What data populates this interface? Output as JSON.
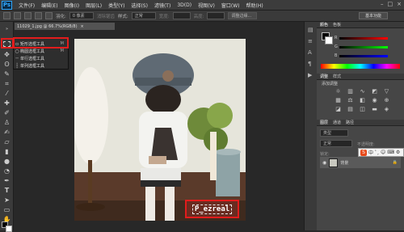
{
  "app": {
    "logo": "Ps"
  },
  "menubar": {
    "items": [
      "文件(F)",
      "编辑(E)",
      "图像(I)",
      "图层(L)",
      "类型(Y)",
      "选择(S)",
      "滤镜(T)",
      "3D(D)",
      "视图(V)",
      "窗口(W)",
      "帮助(H)"
    ]
  },
  "window_controls": {
    "minimize": "–",
    "maximize": "□",
    "close": "×"
  },
  "options_bar": {
    "feather_label": "羽化:",
    "feather_value": "0 像素",
    "antialias_label": "消除锯齿",
    "style_label": "样式:",
    "style_value": "正常",
    "width_label": "宽度:",
    "height_label": "高度:",
    "refine_edge": "调整边缘...",
    "workspace": "基本功能"
  },
  "document": {
    "tab": "11029_1.jpg @ 66.7%(RGB/8)"
  },
  "tool_flyout": {
    "items": [
      {
        "label": "矩形选框工具",
        "shortcut": "M"
      },
      {
        "label": "椭圆选框工具",
        "shortcut": "M"
      },
      {
        "label": "单行选框工具",
        "shortcut": ""
      },
      {
        "label": "单列选框工具",
        "shortcut": ""
      }
    ]
  },
  "watermark": {
    "text": "P_ezreal"
  },
  "color_panel": {
    "tabs": [
      "颜色",
      "色板"
    ],
    "channels": [
      "R",
      "G",
      "B"
    ]
  },
  "adjustments_panel": {
    "tabs": [
      "调整",
      "样式"
    ],
    "title": "添加调整"
  },
  "layers_panel": {
    "tabs": [
      "图层",
      "通道",
      "路径"
    ],
    "kind": "类型",
    "blend_mode": "正常",
    "opacity_label": "不透明度:",
    "lock_label": "锁定:",
    "layer_name": "背景"
  },
  "ime": {
    "text": "中"
  },
  "colors": {
    "accent": "#31a8ff",
    "highlight": "#e21c1c"
  }
}
